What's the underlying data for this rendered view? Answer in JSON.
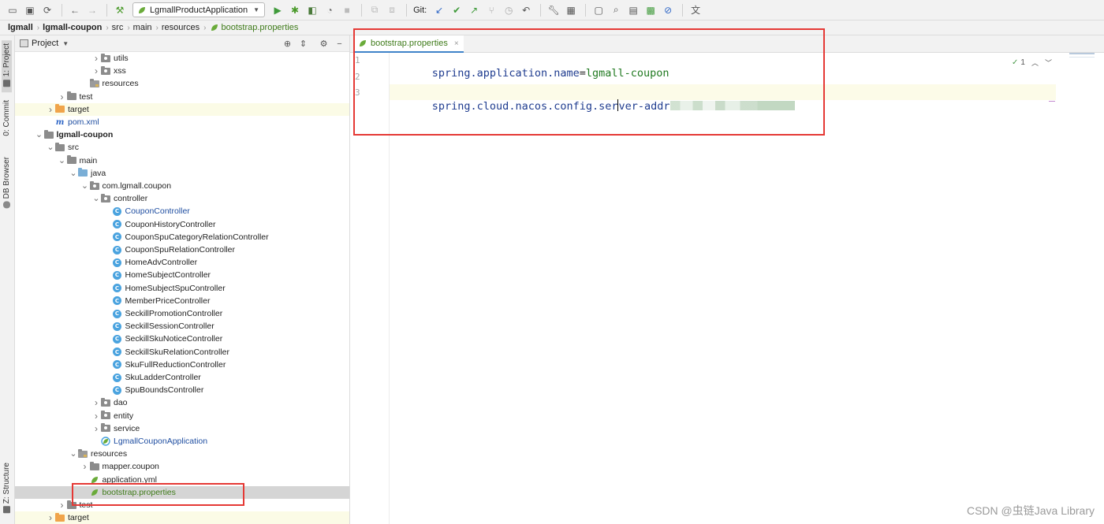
{
  "toolbar": {
    "run_config_label": "LgmallProductApplication",
    "git_label": "Git:"
  },
  "breadcrumb": [
    "lgmall",
    "lgmall-coupon",
    "src",
    "main",
    "resources",
    "bootstrap.properties"
  ],
  "left_tool_tabs": {
    "project": "1: Project",
    "commit": "0: Commit",
    "db_browser": "DB Browser",
    "structure": "Z: Structure"
  },
  "project_panel": {
    "title": "Project",
    "tree": [
      {
        "label": "utils",
        "depth": 6,
        "arrow": "collapsed",
        "icon": "folder-package"
      },
      {
        "label": "xss",
        "depth": 6,
        "arrow": "collapsed",
        "icon": "folder-package"
      },
      {
        "label": "resources",
        "depth": 5,
        "arrow": "none",
        "icon": "folder-resources"
      },
      {
        "label": "test",
        "depth": 3,
        "arrow": "collapsed",
        "icon": "folder"
      },
      {
        "label": "target",
        "depth": 2,
        "arrow": "collapsed",
        "icon": "folder-orange",
        "highlight": "yellow"
      },
      {
        "label": "pom.xml",
        "depth": 2,
        "arrow": "none",
        "icon": "maven",
        "style": "blue"
      },
      {
        "label": "lgmall-coupon",
        "depth": 1,
        "arrow": "expanded",
        "icon": "folder-module",
        "style": "bold"
      },
      {
        "label": "src",
        "depth": 2,
        "arrow": "expanded",
        "icon": "folder"
      },
      {
        "label": "main",
        "depth": 3,
        "arrow": "expanded",
        "icon": "folder"
      },
      {
        "label": "java",
        "depth": 4,
        "arrow": "expanded",
        "icon": "folder-blue"
      },
      {
        "label": "com.lgmall.coupon",
        "depth": 5,
        "arrow": "expanded",
        "icon": "folder-package"
      },
      {
        "label": "controller",
        "depth": 6,
        "arrow": "expanded",
        "icon": "folder-package"
      },
      {
        "label": "CouponController",
        "depth": 7,
        "arrow": "none",
        "icon": "class",
        "style": "blue"
      },
      {
        "label": "CouponHistoryController",
        "depth": 7,
        "arrow": "none",
        "icon": "class"
      },
      {
        "label": "CouponSpuCategoryRelationController",
        "depth": 7,
        "arrow": "none",
        "icon": "class"
      },
      {
        "label": "CouponSpuRelationController",
        "depth": 7,
        "arrow": "none",
        "icon": "class"
      },
      {
        "label": "HomeAdvController",
        "depth": 7,
        "arrow": "none",
        "icon": "class"
      },
      {
        "label": "HomeSubjectController",
        "depth": 7,
        "arrow": "none",
        "icon": "class"
      },
      {
        "label": "HomeSubjectSpuController",
        "depth": 7,
        "arrow": "none",
        "icon": "class"
      },
      {
        "label": "MemberPriceController",
        "depth": 7,
        "arrow": "none",
        "icon": "class"
      },
      {
        "label": "SeckillPromotionController",
        "depth": 7,
        "arrow": "none",
        "icon": "class"
      },
      {
        "label": "SeckillSessionController",
        "depth": 7,
        "arrow": "none",
        "icon": "class"
      },
      {
        "label": "SeckillSkuNoticeController",
        "depth": 7,
        "arrow": "none",
        "icon": "class"
      },
      {
        "label": "SeckillSkuRelationController",
        "depth": 7,
        "arrow": "none",
        "icon": "class"
      },
      {
        "label": "SkuFullReductionController",
        "depth": 7,
        "arrow": "none",
        "icon": "class"
      },
      {
        "label": "SkuLadderController",
        "depth": 7,
        "arrow": "none",
        "icon": "class"
      },
      {
        "label": "SpuBoundsController",
        "depth": 7,
        "arrow": "none",
        "icon": "class"
      },
      {
        "label": "dao",
        "depth": 6,
        "arrow": "collapsed",
        "icon": "folder-package"
      },
      {
        "label": "entity",
        "depth": 6,
        "arrow": "collapsed",
        "icon": "folder-package"
      },
      {
        "label": "service",
        "depth": 6,
        "arrow": "collapsed",
        "icon": "folder-package"
      },
      {
        "label": "LgmallCouponApplication",
        "depth": 6,
        "arrow": "none",
        "icon": "spring-app",
        "style": "blue"
      },
      {
        "label": "resources",
        "depth": 4,
        "arrow": "expanded",
        "icon": "folder-resources"
      },
      {
        "label": "mapper.coupon",
        "depth": 5,
        "arrow": "collapsed",
        "icon": "folder"
      },
      {
        "label": "application.yml",
        "depth": 5,
        "arrow": "none",
        "icon": "spring-leaf"
      },
      {
        "label": "bootstrap.properties",
        "depth": 5,
        "arrow": "none",
        "icon": "spring-leaf",
        "style": "green",
        "selected": true
      },
      {
        "label": "test",
        "depth": 3,
        "arrow": "collapsed",
        "icon": "folder"
      },
      {
        "label": "target",
        "depth": 2,
        "arrow": "collapsed",
        "icon": "folder-orange",
        "highlight": "yellow"
      }
    ]
  },
  "editor": {
    "tab_label": "bootstrap.properties",
    "line_numbers": [
      "1",
      "2",
      "3"
    ],
    "line1_key": "spring.application.name",
    "line1_value": "lgmall-coupon",
    "line3_key_a": "spring.cloud.nacos.config.ser",
    "line3_key_b": "ver-addr",
    "inspection_count": "1"
  },
  "watermark": "CSDN @虫链Java Library",
  "colors": {
    "accent_blue": "#4083c9",
    "property_key": "#1f3c8f",
    "property_value": "#217a21",
    "annotation_red": "#e53935",
    "selected_row": "#d5d5d5"
  }
}
